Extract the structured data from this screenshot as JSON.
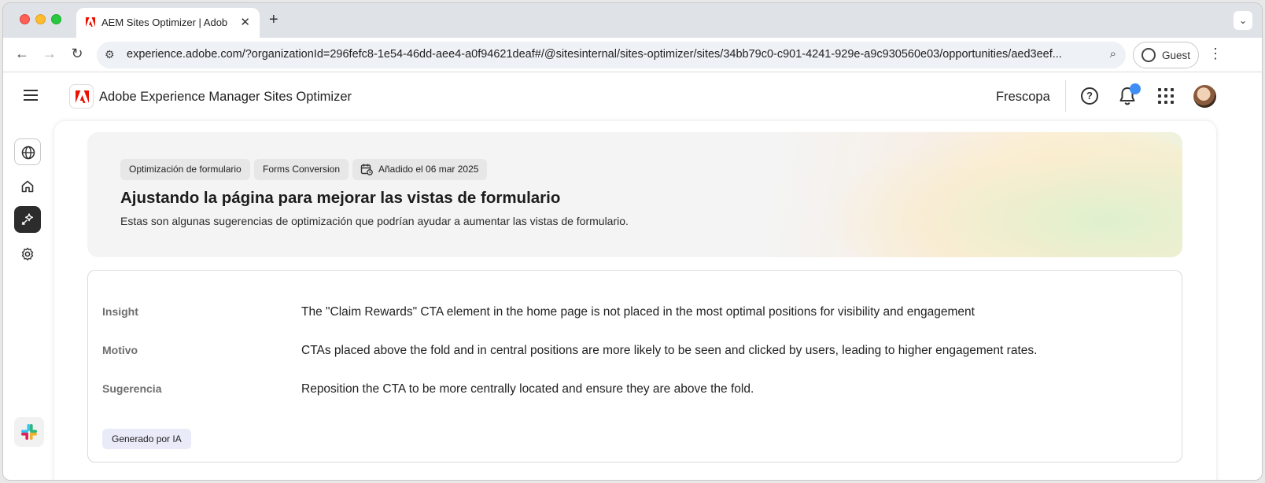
{
  "browser": {
    "tab_title": "AEM Sites Optimizer | Adobe",
    "url": "experience.adobe.com/?organizationId=296fefc8-1e54-46dd-aee4-a0f94621deaf#/@sitesinternal/sites-optimizer/sites/34bb79c0-c901-4241-929e-a9c930560e03/opportunities/aed3eef...",
    "guest_label": "Guest"
  },
  "header": {
    "app_name": "Adobe Experience Manager Sites Optimizer",
    "org_name": "Frescopa"
  },
  "hero": {
    "chips": [
      "Optimización de formulario",
      "Forms Conversion",
      "Añadido el 06 mar 2025"
    ],
    "title": "Ajustando la página para mejorar las vistas de formulario",
    "subtitle": "Estas son algunas sugerencias de optimización que podrían ayudar a aumentar las vistas de formulario."
  },
  "insight": {
    "rows": [
      {
        "label": "Insight",
        "value": "The \"Claim Rewards\" CTA element in the home page is not placed in the most optimal positions for visibility and engagement"
      },
      {
        "label": "Motivo",
        "value": "CTAs placed above the fold and in central positions are more likely to be seen and clicked by users, leading to higher engagement rates."
      },
      {
        "label": "Sugerencia",
        "value": "Reposition the CTA to be more centrally located and ensure they are above the fold."
      }
    ],
    "ai_badge": "Generado por IA"
  },
  "colors": {
    "adobe_red": "#eb1000",
    "notification_dot": "#3f8ef5",
    "active_rail": "#2c2c2c"
  },
  "icons": [
    "globe-icon",
    "home-icon",
    "opportunities-icon",
    "settings-icon",
    "slack-icon",
    "help-icon",
    "bell-icon",
    "apps-grid-icon",
    "calendar-icon"
  ]
}
